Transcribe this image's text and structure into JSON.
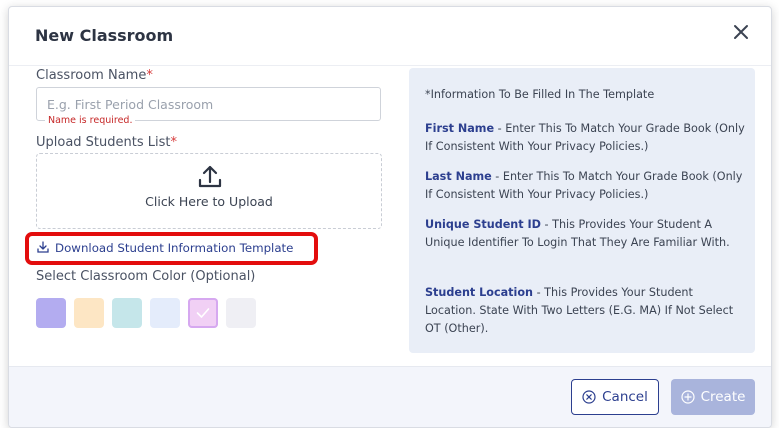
{
  "dialog": {
    "title": "New Classroom",
    "close_icon": "close-icon"
  },
  "form": {
    "classroom_name_label": "Classroom Name",
    "required_mark": "*",
    "classroom_name_placeholder": "E.g. First Period Classroom",
    "classroom_name_value": "",
    "classroom_name_error": "Name is required.",
    "upload_label": "Upload Students List",
    "upload_text": "Click Here to Upload",
    "upload_icon": "upload-icon",
    "download_link_text": "Download Student Information Template",
    "download_icon": "download-icon",
    "color_label": "Select Classroom Color (Optional)",
    "colors": [
      {
        "color": "#b3acf0",
        "selected": false
      },
      {
        "color": "#fde6c4",
        "selected": false
      },
      {
        "color": "#c5e6ea",
        "selected": false
      },
      {
        "color": "#e4ecfb",
        "selected": false
      },
      {
        "color": "#f1d0f5",
        "selected": true
      },
      {
        "color": "#efeff4",
        "selected": false
      }
    ]
  },
  "info_panel": {
    "intro": "*Information To Be Filled In The Template",
    "items": [
      {
        "term": "First Name",
        "text": " - Enter This To Match Your Grade Book (Only If Consistent With Your Privacy Policies.)"
      },
      {
        "term": "Last Name",
        "text": " - Enter This To Match Your Grade Book (Only If Consistent With Your Privacy Policies.)"
      },
      {
        "term": "Unique Student ID",
        "text": " - This Provides Your Student A Unique Identifier To Login That They Are Familiar With."
      },
      {
        "term": "Student Location",
        "text": " - This Provides Your Student Location. State With Two Letters (E.G. MA) If Not Select OT (Other)."
      }
    ]
  },
  "footer": {
    "cancel_label": "Cancel",
    "create_label": "Create"
  },
  "colors": {
    "accent": "#2c3f8f",
    "error": "#c62828",
    "highlight": "#e30d0d",
    "info_bg": "#e9eef7",
    "create_disabled": "#a9b4dc"
  }
}
